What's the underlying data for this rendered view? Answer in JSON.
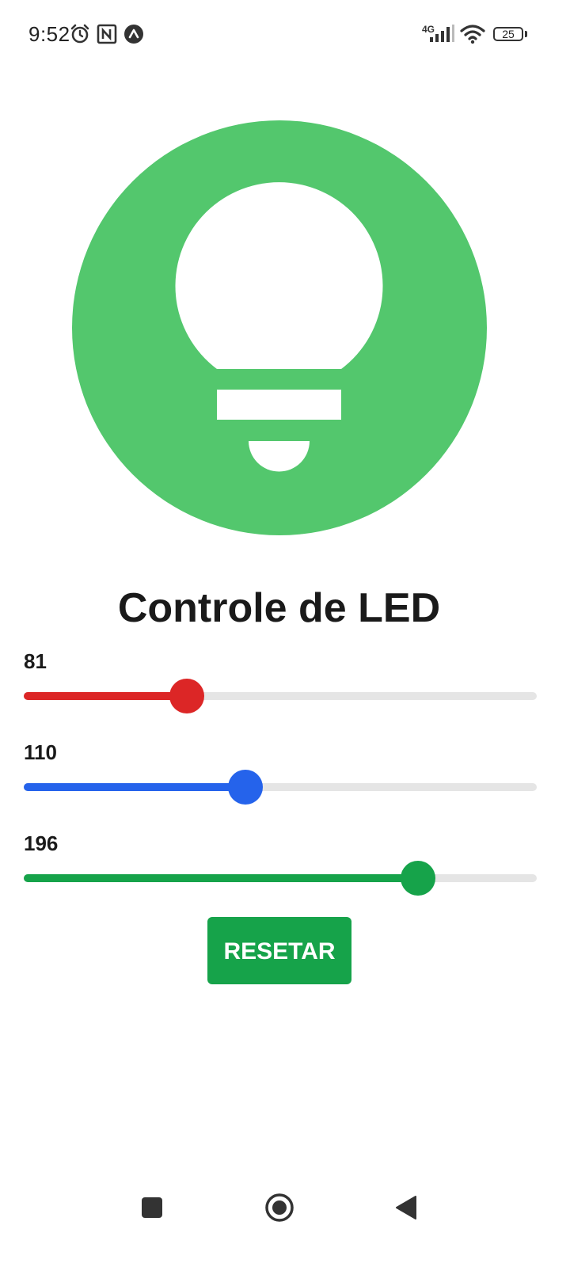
{
  "status_bar": {
    "time": "9:52",
    "network_type": "4G",
    "battery_level": "25",
    "icons": [
      "alarm-icon",
      "nfc-icon",
      "expo-app-icon",
      "signal-icon",
      "wifi-icon",
      "battery-icon"
    ]
  },
  "bulb": {
    "icon": "lightbulb-icon",
    "circle_color": "#53c76d",
    "bulb_color": "#ffffff"
  },
  "title": "Controle de LED",
  "sliders": [
    {
      "name": "red",
      "value": "81",
      "max": 255,
      "color": "#dc2626"
    },
    {
      "name": "blue",
      "value": "110",
      "max": 255,
      "color": "#2563eb"
    },
    {
      "name": "green",
      "value": "196",
      "max": 255,
      "color": "#16a34a"
    }
  ],
  "reset_button": {
    "label": "RESETAR",
    "color": "#16a34a"
  },
  "nav_bar": {
    "icons": [
      "recents-icon",
      "home-icon",
      "back-icon"
    ]
  }
}
